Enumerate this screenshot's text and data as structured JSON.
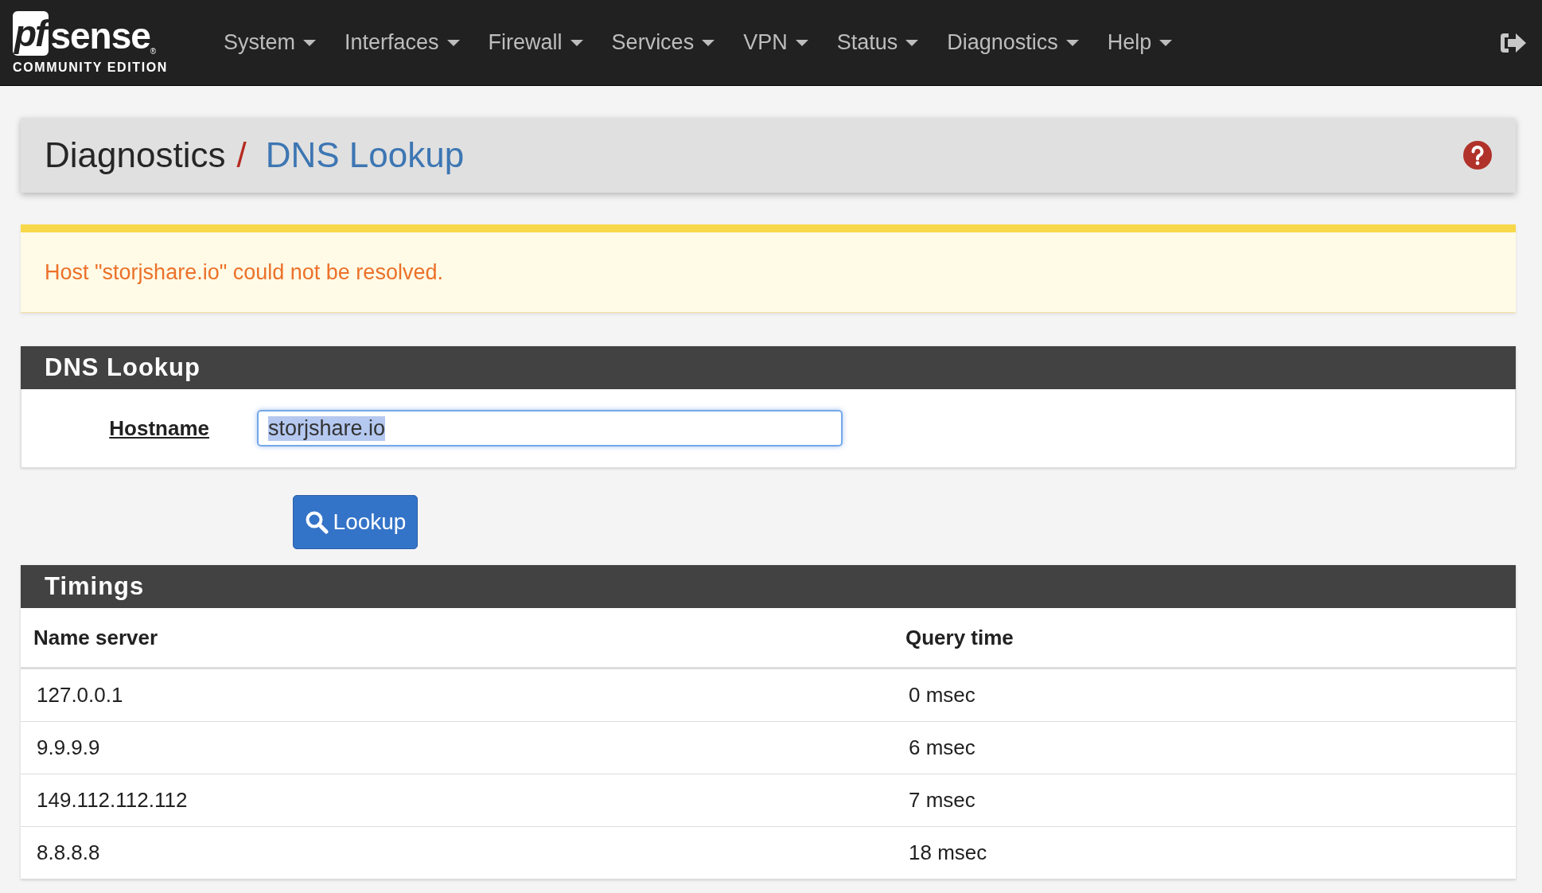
{
  "logo": {
    "prefix": "pf",
    "name": "sense",
    "mark": "®",
    "tagline": "COMMUNITY EDITION"
  },
  "nav": [
    {
      "label": "System"
    },
    {
      "label": "Interfaces"
    },
    {
      "label": "Firewall"
    },
    {
      "label": "Services"
    },
    {
      "label": "VPN"
    },
    {
      "label": "Status"
    },
    {
      "label": "Diagnostics"
    },
    {
      "label": "Help"
    }
  ],
  "breadcrumb": {
    "parent": "Diagnostics",
    "separator": "/",
    "current": "DNS Lookup"
  },
  "alert": {
    "text": "Host \"storjshare.io\" could not be resolved."
  },
  "lookup_panel": {
    "title": "DNS Lookup",
    "label": "Hostname",
    "value": "storjshare.io",
    "value_selected": true,
    "button": "Lookup"
  },
  "timings": {
    "title": "Timings",
    "columns": [
      "Name server",
      "Query time"
    ],
    "rows": [
      [
        "127.0.0.1",
        "0 msec"
      ],
      [
        "9.9.9.9",
        "6 msec"
      ],
      [
        "149.112.112.112",
        "7 msec"
      ],
      [
        "8.8.8.8",
        "18 msec"
      ]
    ]
  }
}
